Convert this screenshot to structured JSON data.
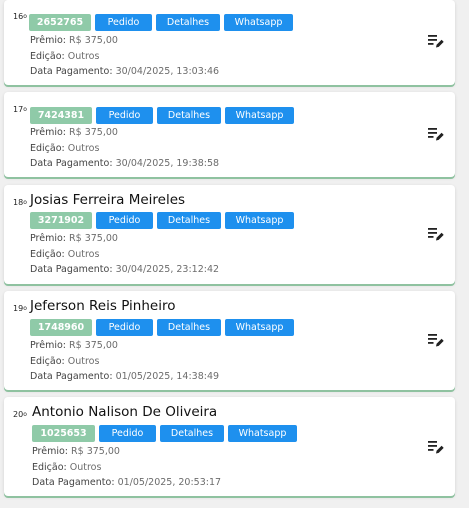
{
  "buttons": {
    "pedido": "Pedido",
    "detalhes": "Detalhes",
    "whatsapp": "Whatsapp"
  },
  "labels": {
    "premio": "Prêmio:",
    "edicao": "Edição:",
    "data_pagamento": "Data Pagamento:"
  },
  "colors": {
    "code_chip": "#8fcaa8",
    "action_button": "#1e90ee"
  },
  "icons": {
    "edit": "edit-list-icon"
  },
  "entries": [
    {
      "rank": "16",
      "rank_suffix": "o",
      "name": "",
      "code": "2652765",
      "premio": "R$ 375,00",
      "edicao": "Outros",
      "data_pagamento": "30/04/2025, 13:03:46"
    },
    {
      "rank": "17",
      "rank_suffix": "o",
      "name": "",
      "code": "7424381",
      "premio": "R$ 375,00",
      "edicao": "Outros",
      "data_pagamento": "30/04/2025, 19:38:58"
    },
    {
      "rank": "18",
      "rank_suffix": "o",
      "name": "Josias Ferreira Meireles",
      "code": "3271902",
      "premio": "R$ 375,00",
      "edicao": "Outros",
      "data_pagamento": "30/04/2025, 23:12:42"
    },
    {
      "rank": "19",
      "rank_suffix": "o",
      "name": "Jeferson Reis Pinheiro",
      "code": "1748960",
      "premio": "R$ 375,00",
      "edicao": "Outros",
      "data_pagamento": "01/05/2025, 14:38:49"
    },
    {
      "rank": "20",
      "rank_suffix": "o",
      "name": "Antonio Nalison De Oliveira",
      "code": "1025653",
      "premio": "R$ 375,00",
      "edicao": "Outros",
      "data_pagamento": "01/05/2025, 20:53:17"
    }
  ]
}
